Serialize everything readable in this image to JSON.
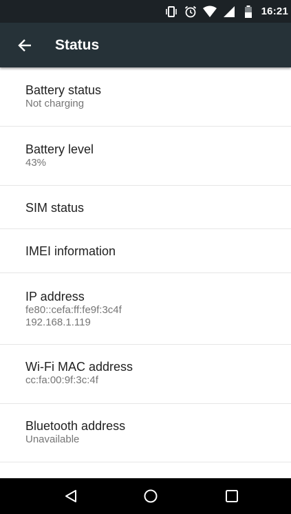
{
  "status_bar": {
    "time": "16:21",
    "icons": [
      "vibrate-icon",
      "alarm-icon",
      "wifi-icon",
      "signal-icon",
      "battery-icon"
    ]
  },
  "app_bar": {
    "title": "Status",
    "back_icon": "arrow-back-icon"
  },
  "items": [
    {
      "title": "Battery status",
      "subtitle": "Not charging"
    },
    {
      "title": "Battery level",
      "subtitle": "43%"
    },
    {
      "title": "SIM status"
    },
    {
      "title": "IMEI information"
    },
    {
      "title": "IP address",
      "subtitle_lines": [
        "fe80::cefa:ff:fe9f:3c4f",
        "192.168.1.119"
      ]
    },
    {
      "title": "Wi-Fi MAC address",
      "subtitle": "cc:fa:00:9f:3c:4f"
    },
    {
      "title": "Bluetooth address",
      "subtitle": "Unavailable"
    }
  ],
  "nav_bar": {
    "buttons": [
      "back-triangle-icon",
      "home-circle-icon",
      "recents-square-icon"
    ]
  },
  "colors": {
    "status_bar": "#1c2226",
    "app_bar": "#263238",
    "primary_text": "#212121",
    "secondary_text": "#757575",
    "divider": "#e6e6e6",
    "nav_bar": "#000000"
  }
}
